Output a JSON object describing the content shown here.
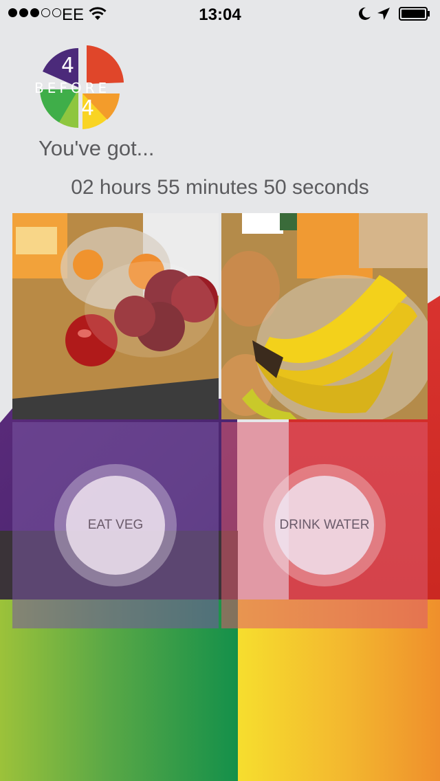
{
  "status_bar": {
    "carrier": "EE",
    "time": "13:04"
  },
  "logo": {
    "top": "4",
    "middle": "BEFORE",
    "bottom": "4"
  },
  "prompt": "You've got...",
  "countdown": "02 hours 55 minutes 50 seconds",
  "actions": [
    {
      "label": "EAT VEG"
    },
    {
      "label": "DRINK WATER"
    }
  ],
  "icons": [
    "wifi-icon",
    "moon-icon",
    "location-arrow-icon",
    "battery-icon"
  ]
}
